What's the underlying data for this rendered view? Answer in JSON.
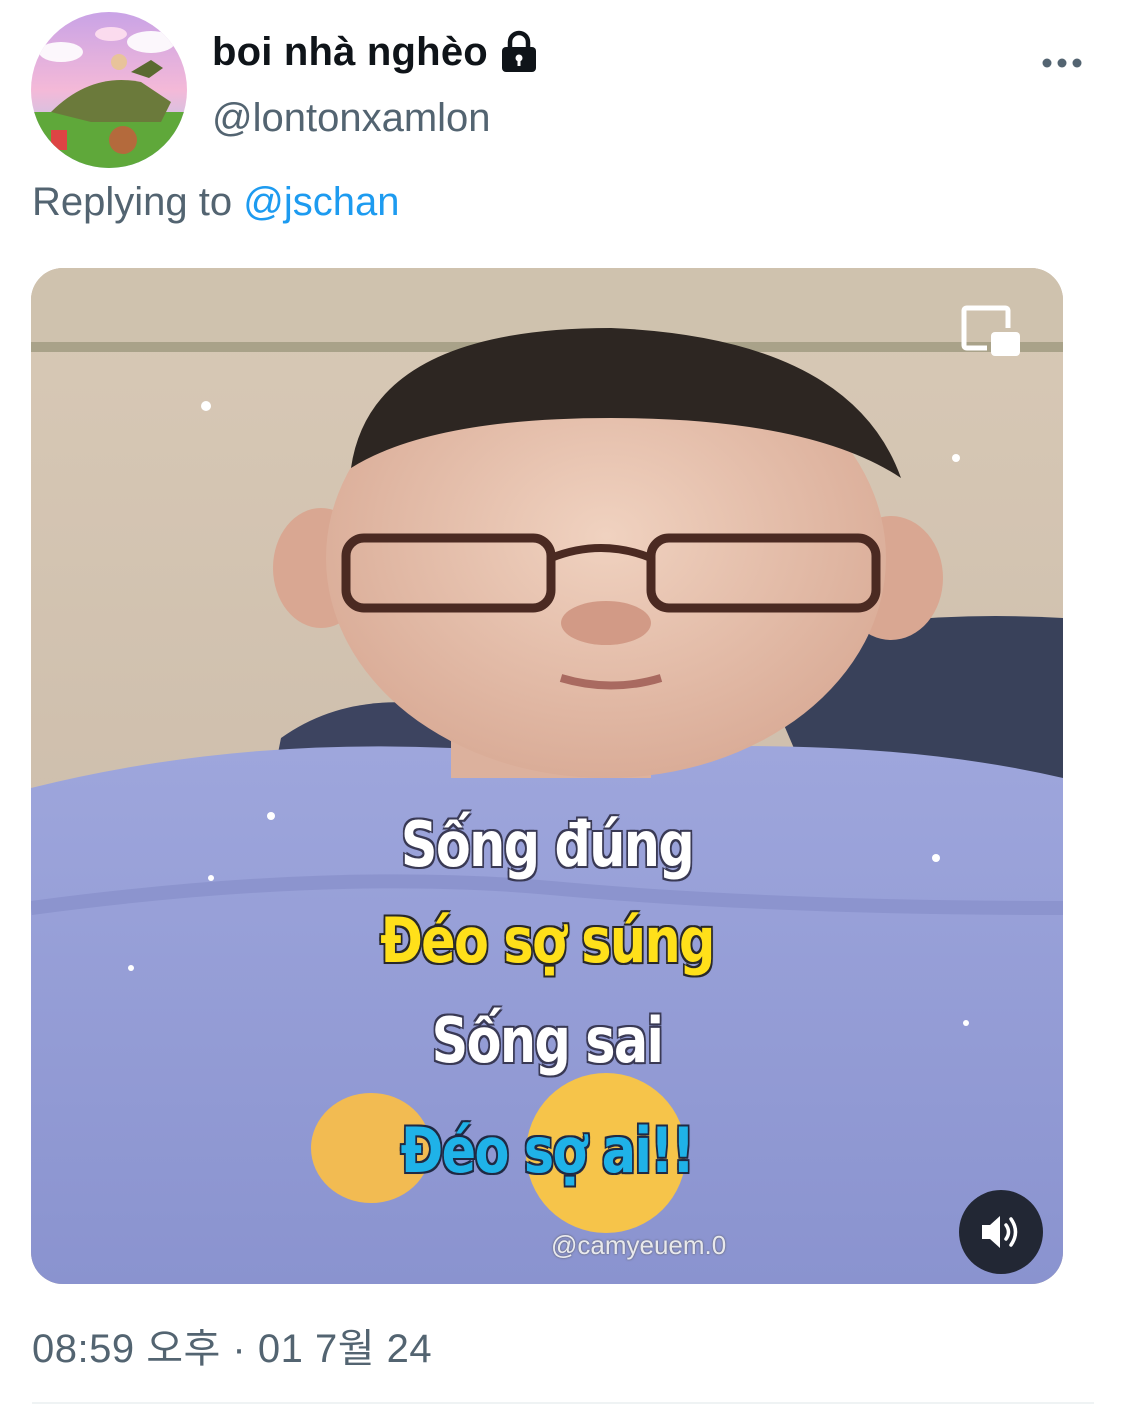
{
  "tweet": {
    "display_name": "boi nhà nghèo",
    "handle": "@lontonxamlon",
    "reply_prefix": "Replying to",
    "reply_mention": "@jschan",
    "timestamp": "08:59 오후 · 01 7월 24",
    "icons": {
      "lock": "lock-icon",
      "more": "more-dots-icon",
      "pip": "picture-in-picture-icon",
      "volume": "speaker-volume-icon"
    }
  },
  "media": {
    "type": "video",
    "captions": [
      {
        "text": "Sống đúng",
        "color": "white"
      },
      {
        "text": "Đéo sợ súng",
        "color": "yellow"
      },
      {
        "text": "Sống sai",
        "color": "white"
      },
      {
        "text": "Đéo sợ ai!!",
        "color": "blue"
      }
    ],
    "watermark": "@camyeuem.0"
  },
  "colors": {
    "link": "#1d9bf0",
    "secondary_text": "#536471",
    "primary_text": "#0f1419"
  }
}
